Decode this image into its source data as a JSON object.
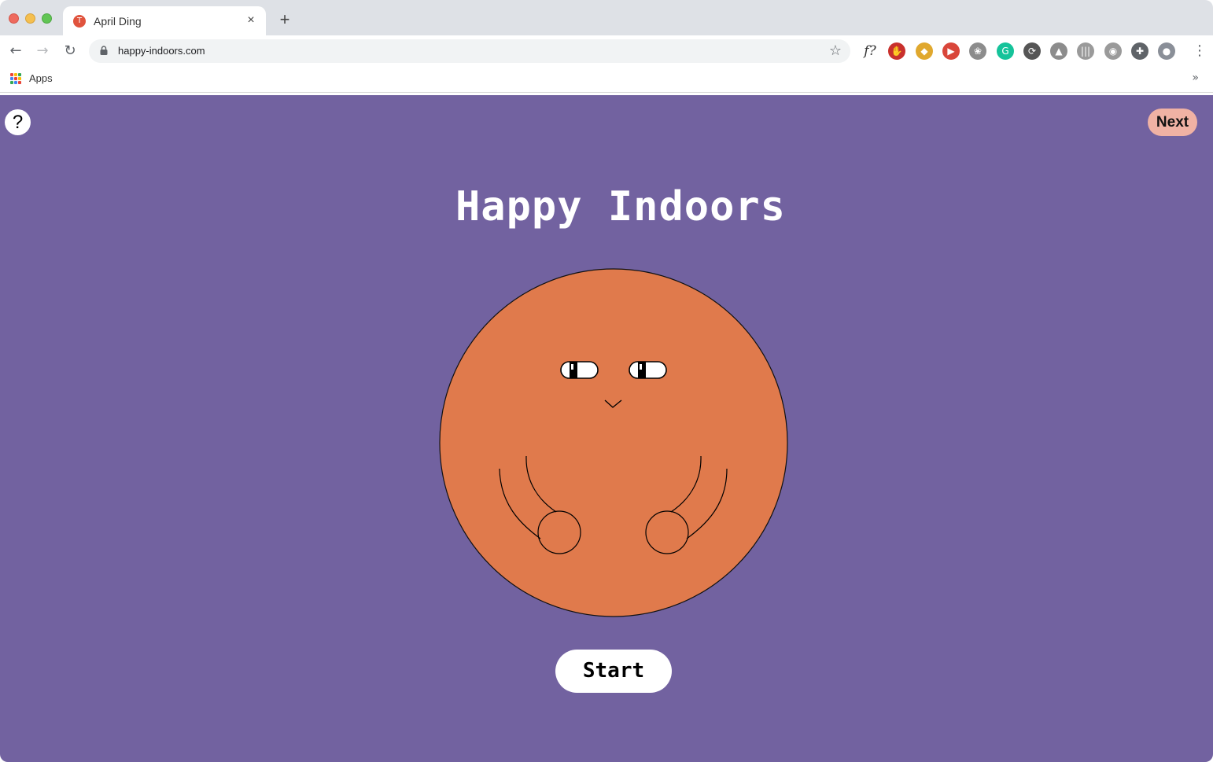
{
  "browser": {
    "tab": {
      "title": "April Ding",
      "favicon_letter": "T",
      "close_icon": "×"
    },
    "new_tab_icon": "+",
    "nav": {
      "back": "←",
      "forward": "→",
      "reload": "↻"
    },
    "address": {
      "url": "happy-indoors.com",
      "bookmark_icon": "☆"
    },
    "extensions": [
      {
        "name": "fx-extension-icon",
        "glyph": "f?",
        "color": "transparent"
      },
      {
        "name": "adblock-extension-icon",
        "glyph": "✋",
        "color": "#c9302c"
      },
      {
        "name": "pinwheel-extension-icon",
        "glyph": "◆",
        "color": "#e0a82e"
      },
      {
        "name": "media-extension-icon",
        "glyph": "▶",
        "color": "#d9463a"
      },
      {
        "name": "paw-extension-icon",
        "glyph": "❀",
        "color": "#8c8c8c"
      },
      {
        "name": "grammarly-extension-icon",
        "glyph": "G",
        "color": "#15c39a"
      },
      {
        "name": "sync-extension-icon",
        "glyph": "⟳",
        "color": "#555555"
      },
      {
        "name": "drive-extension-icon",
        "glyph": "▲",
        "color": "#8c8c8c"
      },
      {
        "name": "barcode-extension-icon",
        "glyph": "|||",
        "color": "#9a9a9a"
      },
      {
        "name": "camera-extension-icon",
        "glyph": "◉",
        "color": "#9a9a9a"
      },
      {
        "name": "puzzle-extension-icon",
        "glyph": "✚",
        "color": "#5f6368"
      },
      {
        "name": "profile-avatar",
        "glyph": "●",
        "color": "#8a8f98"
      }
    ],
    "menu_icon": "⋮",
    "bookmarks": {
      "apps_label": "Apps",
      "overflow": "»"
    }
  },
  "page": {
    "help_label": "?",
    "next_label": "Next",
    "title": "Happy Indoors",
    "start_label": "Start",
    "colors": {
      "background": "#7262a0",
      "mascot_body": "#e07a4c",
      "next_button": "#f0b2a4"
    }
  }
}
